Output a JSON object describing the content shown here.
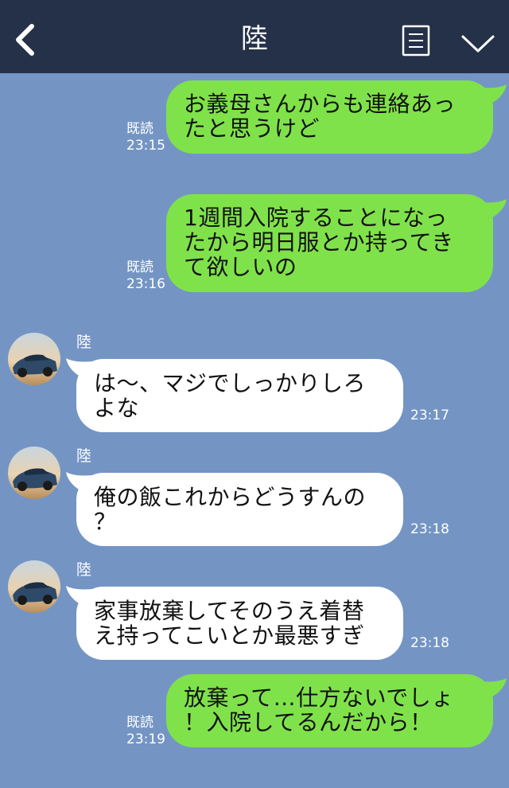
{
  "header": {
    "title": "陸",
    "back_icon": "chevron-left-icon",
    "menu_icon": "list-icon",
    "expand_icon": "chevron-down-icon"
  },
  "colors": {
    "header_bg": "#253149",
    "chat_bg": "#7495c4",
    "my_bubble": "#80e24a",
    "their_bubble": "#ffffff"
  },
  "messages": [
    {
      "side": "me",
      "lines": [
        "お義母さんからも連絡あっ",
        "たと思うけど"
      ],
      "read": "既読",
      "time": "23:15"
    },
    {
      "side": "me",
      "lines": [
        "1週間入院することになっ",
        "たから明日服とか持ってき",
        "て欲しいの"
      ],
      "read": "既読",
      "time": "23:16"
    },
    {
      "side": "them",
      "sender": "陸",
      "lines": [
        "は～、マジでしっかりしろ",
        "よな"
      ],
      "time": "23:17"
    },
    {
      "side": "them",
      "sender": "陸",
      "lines": [
        "俺の飯これからどうすんの",
        "？"
      ],
      "time": "23:18"
    },
    {
      "side": "them",
      "sender": "陸",
      "lines": [
        "家事放棄してそのうえ着替",
        "え持ってこいとか最悪すぎ"
      ],
      "time": "23:18"
    },
    {
      "side": "me",
      "lines": [
        "放棄って…仕方ないでしょ",
        "！入院してるんだから！"
      ],
      "read": "既読",
      "time": "23:19"
    }
  ]
}
